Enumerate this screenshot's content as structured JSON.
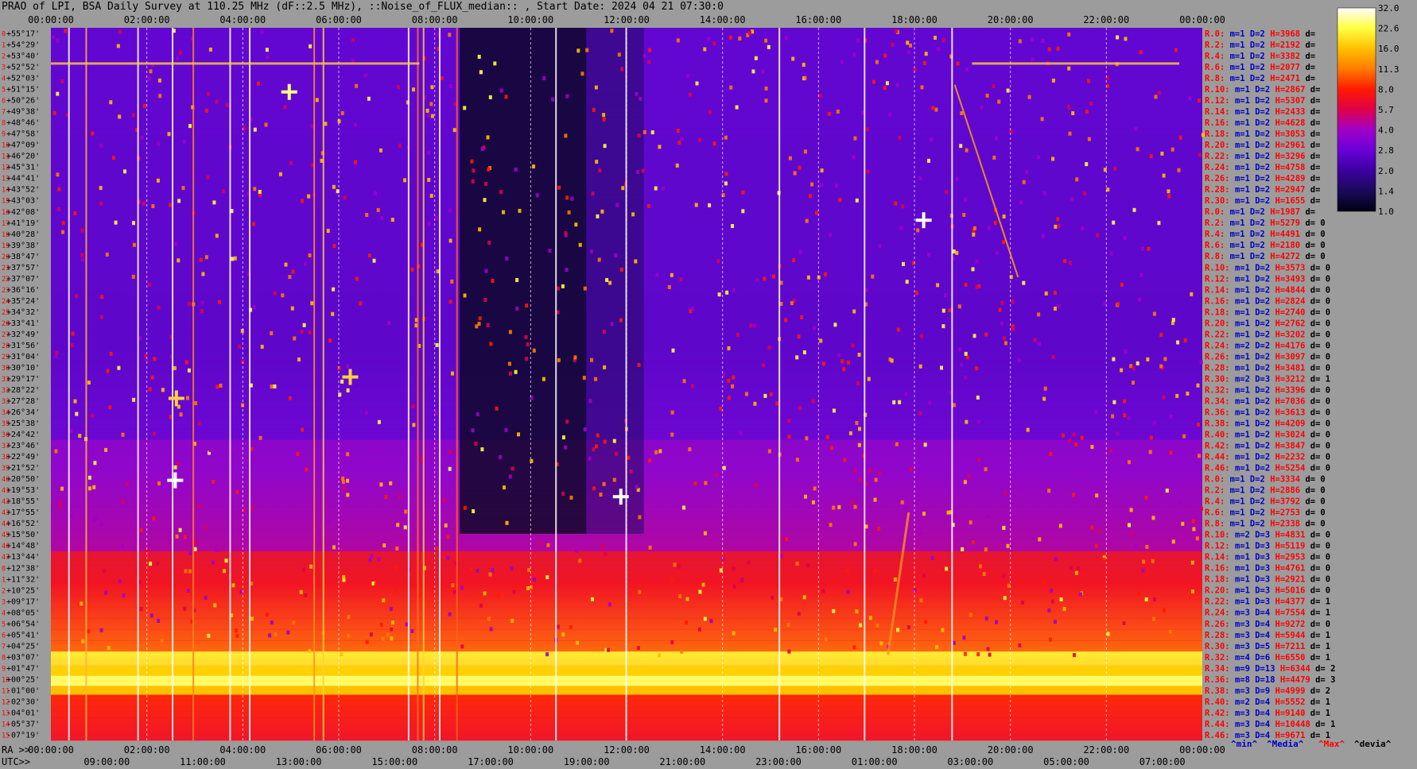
{
  "title": "PRAO of LPI, BSA Daily Survey at 110.25 MHz (dF::2.5 MHz), ::Noise_of_FLUX_median:: , Start Date: 2024 04 21 07:30:0",
  "chart_data": {
    "type": "heatmap",
    "top_time_ticks": [
      "00:00:00",
      "02:00:00",
      "04:00:00",
      "06:00:00",
      "08:00:00",
      "10:00:00",
      "12:00:00",
      "14:00:00",
      "16:00:00",
      "18:00:00",
      "20:00:00",
      "22:00:00",
      "00:00:00"
    ],
    "bottom_ra_prefix": "RA >>",
    "bottom_ra_ticks": [
      "00:00:00",
      "02:00:00",
      "04:00:00",
      "06:00:00",
      "08:00:00",
      "10:00:00",
      "12:00:00",
      "14:00:00",
      "16:00:00",
      "18:00:00",
      "20:00:00",
      "22:00:00",
      "00:00:00"
    ],
    "bottom_utc_prefix": "UTC>>",
    "bottom_utc_ticks": [
      "09:00:00",
      "11:00:00",
      "13:00:00",
      "15:00:00",
      "17:00:00",
      "19:00:00",
      "21:00:00",
      "23:00:00",
      "01:00:00",
      "03:00:00",
      "05:00:00",
      "07:00:00"
    ],
    "declinations": [
      "+55°17'",
      "+54°29'",
      "+53°40'",
      "+52°52'",
      "+52°03'",
      "+51°15'",
      "+50°26'",
      "+49°38'",
      "+48°46'",
      "+47°58'",
      "+47°09'",
      "+46°20'",
      "+45°31'",
      "+44°41'",
      "+43°52'",
      "+43°03'",
      "+42°08'",
      "+41°19'",
      "+40°28'",
      "+39°38'",
      "+38°47'",
      "+37°57'",
      "+37°07'",
      "+36°16'",
      "+35°24'",
      "+34°32'",
      "+33°41'",
      "+32°49'",
      "+31°56'",
      "+31°04'",
      "+30°10'",
      "+29°17'",
      "+28°22'",
      "+27°28'",
      "+26°34'",
      "+25°38'",
      "+24°42'",
      "+23°46'",
      "+22°49'",
      "+21°52'",
      "+20°50'",
      "+19°53'",
      "+18°55'",
      "+17°55'",
      "+16°52'",
      "+15°50'",
      "+14°48'",
      "+13°44'",
      "+12°38'",
      "+11°32'",
      "+10°25'",
      "+09°17'",
      "+08°05'",
      "+06°54'",
      "+05°41'",
      "+04°25'",
      "+03°07'",
      "+01°47'",
      "+00°25'",
      "-01°00'",
      "-02°30'",
      "-04°01'",
      "-05°37'",
      "-07°19'"
    ],
    "channel_labels": [
      {
        "r": "R.0:",
        "m": "m=1",
        "d": "D=2",
        "h": "H=3968",
        "v": "d="
      },
      {
        "r": "R.2:",
        "m": "m=1",
        "d": "D=2",
        "h": "H=2192",
        "v": "d="
      },
      {
        "r": "R.4:",
        "m": "m=1",
        "d": "D=2",
        "h": "H=3382",
        "v": "d="
      },
      {
        "r": "R.6:",
        "m": "m=1",
        "d": "D=2",
        "h": "H=2077",
        "v": "d="
      },
      {
        "r": "R.8:",
        "m": "m=1",
        "d": "D=2",
        "h": "H=2471",
        "v": "d="
      },
      {
        "r": "R.10:",
        "m": "m=1",
        "d": "D=2",
        "h": "H=2867",
        "v": "d="
      },
      {
        "r": "R.12:",
        "m": "m=1",
        "d": "D=2",
        "h": "H=5307",
        "v": "d="
      },
      {
        "r": "R.14:",
        "m": "m=1",
        "d": "D=2",
        "h": "H=2433",
        "v": "d="
      },
      {
        "r": "R.16:",
        "m": "m=1",
        "d": "D=2",
        "h": "H=4628",
        "v": "d="
      },
      {
        "r": "R.18:",
        "m": "m=1",
        "d": "D=2",
        "h": "H=3053",
        "v": "d="
      },
      {
        "r": "R.20:",
        "m": "m=1",
        "d": "D=2",
        "h": "H=2961",
        "v": "d="
      },
      {
        "r": "R.22:",
        "m": "m=1",
        "d": "D=2",
        "h": "H=3296",
        "v": "d="
      },
      {
        "r": "R.24:",
        "m": "m=1",
        "d": "D=2",
        "h": "H=4758",
        "v": "d="
      },
      {
        "r": "R.26:",
        "m": "m=1",
        "d": "D=2",
        "h": "H=4289",
        "v": "d="
      },
      {
        "r": "R.28:",
        "m": "m=1",
        "d": "D=2",
        "h": "H=2947",
        "v": "d="
      },
      {
        "r": "R.30:",
        "m": "m=1",
        "d": "D=2",
        "h": "H=1655",
        "v": "d="
      },
      {
        "r": "R.0:",
        "m": "m=1",
        "d": "D=2",
        "h": "H=1987",
        "v": "d="
      },
      {
        "r": "R.2:",
        "m": "m=1",
        "d": "D=2",
        "h": "H=5279",
        "v": "d= 0"
      },
      {
        "r": "R.4:",
        "m": "m=1",
        "d": "D=2",
        "h": "H=4491",
        "v": "d= 0"
      },
      {
        "r": "R.6:",
        "m": "m=1",
        "d": "D=2",
        "h": "H=2180",
        "v": "d= 0"
      },
      {
        "r": "R.8:",
        "m": "m=1",
        "d": "D=2",
        "h": "H=4272",
        "v": "d= 0"
      },
      {
        "r": "R.10:",
        "m": "m=1",
        "d": "D=2",
        "h": "H=3573",
        "v": "d= 0"
      },
      {
        "r": "R.12:",
        "m": "m=1",
        "d": "D=2",
        "h": "H=3493",
        "v": "d= 0"
      },
      {
        "r": "R.14:",
        "m": "m=1",
        "d": "D=2",
        "h": "H=4844",
        "v": "d= 0"
      },
      {
        "r": "R.16:",
        "m": "m=1",
        "d": "D=2",
        "h": "H=2824",
        "v": "d= 0"
      },
      {
        "r": "R.18:",
        "m": "m=1",
        "d": "D=2",
        "h": "H=2740",
        "v": "d= 0"
      },
      {
        "r": "R.20:",
        "m": "m=1",
        "d": "D=2",
        "h": "H=2762",
        "v": "d= 0"
      },
      {
        "r": "R.22:",
        "m": "m=1",
        "d": "D=2",
        "h": "H=3202",
        "v": "d= 0"
      },
      {
        "r": "R.24:",
        "m": "m=2",
        "d": "D=2",
        "h": "H=4176",
        "v": "d= 0"
      },
      {
        "r": "R.26:",
        "m": "m=1",
        "d": "D=2",
        "h": "H=3097",
        "v": "d= 0"
      },
      {
        "r": "R.28:",
        "m": "m=1",
        "d": "D=2",
        "h": "H=3481",
        "v": "d= 0"
      },
      {
        "r": "R.30:",
        "m": "m=2",
        "d": "D=3",
        "h": "H=3212",
        "v": "d= 1"
      },
      {
        "r": "R.32:",
        "m": "m=1",
        "d": "D=2",
        "h": "H=3396",
        "v": "d= 0"
      },
      {
        "r": "R.34:",
        "m": "m=1",
        "d": "D=2",
        "h": "H=7036",
        "v": "d= 0"
      },
      {
        "r": "R.36:",
        "m": "m=1",
        "d": "D=2",
        "h": "H=3613",
        "v": "d= 0"
      },
      {
        "r": "R.38:",
        "m": "m=1",
        "d": "D=2",
        "h": "H=4209",
        "v": "d= 0"
      },
      {
        "r": "R.40:",
        "m": "m=1",
        "d": "D=2",
        "h": "H=3024",
        "v": "d= 0"
      },
      {
        "r": "R.42:",
        "m": "m=1",
        "d": "D=2",
        "h": "H=3847",
        "v": "d= 0"
      },
      {
        "r": "R.44:",
        "m": "m=1",
        "d": "D=2",
        "h": "H=2232",
        "v": "d= 0"
      },
      {
        "r": "R.46:",
        "m": "m=1",
        "d": "D=2",
        "h": "H=5254",
        "v": "d= 0"
      },
      {
        "r": "R.0:",
        "m": "m=1",
        "d": "D=2",
        "h": "H=3334",
        "v": "d= 0"
      },
      {
        "r": "R.2:",
        "m": "m=1",
        "d": "D=2",
        "h": "H=2886",
        "v": "d= 0"
      },
      {
        "r": "R.4:",
        "m": "m=1",
        "d": "D=2",
        "h": "H=3792",
        "v": "d= 0"
      },
      {
        "r": "R.6:",
        "m": "m=1",
        "d": "D=2",
        "h": "H=2753",
        "v": "d= 0"
      },
      {
        "r": "R.8:",
        "m": "m=1",
        "d": "D=2",
        "h": "H=2338",
        "v": "d= 0"
      },
      {
        "r": "R.10:",
        "m": "m=2",
        "d": "D=3",
        "h": "H=4831",
        "v": "d= 0"
      },
      {
        "r": "R.12:",
        "m": "m=1",
        "d": "D=3",
        "h": "H=5119",
        "v": "d= 0"
      },
      {
        "r": "R.14:",
        "m": "m=1",
        "d": "D=3",
        "h": "H=2953",
        "v": "d= 0"
      },
      {
        "r": "R.16:",
        "m": "m=1",
        "d": "D=3",
        "h": "H=4761",
        "v": "d= 0"
      },
      {
        "r": "R.18:",
        "m": "m=1",
        "d": "D=3",
        "h": "H=2921",
        "v": "d= 0"
      },
      {
        "r": "R.20:",
        "m": "m=1",
        "d": "D=3",
        "h": "H=5016",
        "v": "d= 0"
      },
      {
        "r": "R.22:",
        "m": "m=1",
        "d": "D=3",
        "h": "H=4377",
        "v": "d= 1"
      },
      {
        "r": "R.24:",
        "m": "m=3",
        "d": "D=4",
        "h": "H=7554",
        "v": "d= 1"
      },
      {
        "r": "R.26:",
        "m": "m=3",
        "d": "D=4",
        "h": "H=9272",
        "v": "d= 0"
      },
      {
        "r": "R.28:",
        "m": "m=3",
        "d": "D=4",
        "h": "H=5944",
        "v": "d= 1"
      },
      {
        "r": "R.30:",
        "m": "m=3",
        "d": "D=5",
        "h": "H=7211",
        "v": "d= 1"
      },
      {
        "r": "R.32:",
        "m": "m=4",
        "d": "D=6",
        "h": "H=6550",
        "v": "d= 1"
      },
      {
        "r": "R.34:",
        "m": "m=9",
        "d": "D=13",
        "h": "H=6344",
        "v": "d= 2"
      },
      {
        "r": "R.36:",
        "m": "m=8",
        "d": "D=18",
        "h": "H=4479",
        "v": "d= 3"
      },
      {
        "r": "R.38:",
        "m": "m=3",
        "d": "D=9",
        "h": "H=4999",
        "v": "d= 2"
      },
      {
        "r": "R.40:",
        "m": "m=2",
        "d": "D=4",
        "h": "H=5552",
        "v": "d= 1"
      },
      {
        "r": "R.42:",
        "m": "m=3",
        "d": "D=4",
        "h": "H=9140",
        "v": "d= 1"
      },
      {
        "r": "R.44:",
        "m": "m=3",
        "d": "D=4",
        "h": "H=10448",
        "v": "d= 1"
      },
      {
        "r": "R.46:",
        "m": "m=3",
        "d": "D=4",
        "h": "H=9671",
        "v": "d= 1"
      }
    ],
    "bottom_legend": [
      "^min^",
      "^Media^",
      "^Max^",
      "^devia^"
    ],
    "colorbar": {
      "ticks": [
        "32.0",
        "22.6",
        "16.0",
        "11.3",
        "8.0",
        "5.7",
        "4.0",
        "2.8",
        "2.0",
        "1.4",
        "1.0"
      ],
      "scale": "log"
    },
    "colors": {
      "background": "#9c9c9c",
      "label_red": "#ff0000",
      "label_blue": "#0000c8",
      "axis_text": "#000000",
      "cmap": [
        "#000010",
        "#1a0a5a",
        "#3b00a0",
        "#6a00d8",
        "#a000c8",
        "#e0004a",
        "#ff1a00",
        "#ff7a00",
        "#ffc000",
        "#ffff40",
        "#ffffff"
      ]
    }
  }
}
